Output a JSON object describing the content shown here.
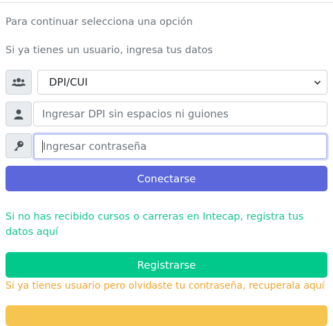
{
  "intro": {
    "prompt": "Para continuar selecciona una opción",
    "login_hint": "Si ya tienes un usuario, ingresa tus datos"
  },
  "login": {
    "id_type": {
      "icon": "users-icon",
      "selected": "DPI/CUI"
    },
    "id_field": {
      "icon": "user-icon",
      "placeholder": "Ingresar DPI sin espacios ni guiones",
      "value": ""
    },
    "password_field": {
      "icon": "key-icon",
      "placeholder": "Ingresar contraseña",
      "value": ""
    },
    "connect_label": "Conectarse"
  },
  "register": {
    "hint": "Si no has recibido cursos o carreras en Intecap, registra tus datos aquí",
    "button_label": "Registrarse"
  },
  "recover": {
    "hint": "Si ya tienes usuario pero olvidaste tu contraseña, recuperala aquí"
  },
  "colors": {
    "connect_button": "#5b67da",
    "register_button": "#00c98b",
    "register_text": "#16c58a",
    "recover_text": "#f0a532",
    "recover_button": "#f5c550"
  }
}
